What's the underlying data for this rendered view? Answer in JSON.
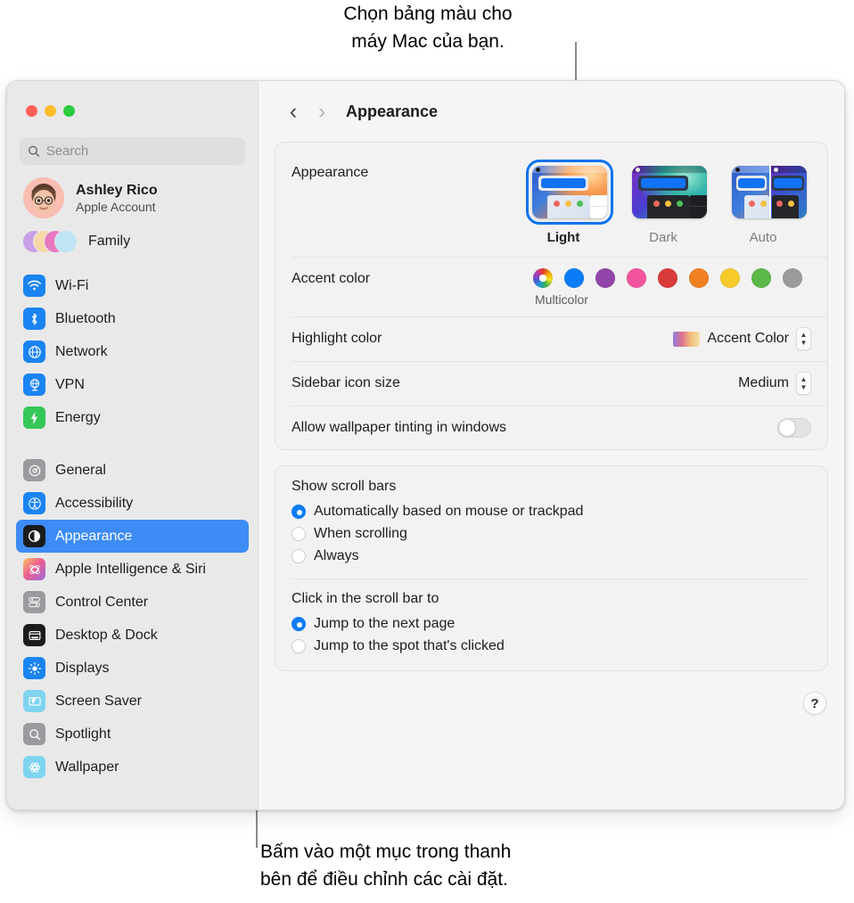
{
  "callouts": {
    "top": "Chọn bảng màu cho\nmáy Mac của bạn.",
    "bottom": "Bấm vào một mục trong thanh\nbên để điều chỉnh các cài đặt."
  },
  "window": {
    "traffic_lights": [
      {
        "name": "close",
        "color": "#ff6159"
      },
      {
        "name": "minimize",
        "color": "#ffbd2e"
      },
      {
        "name": "zoom",
        "color": "#2bcc3e"
      }
    ]
  },
  "sidebar": {
    "search": {
      "value": "",
      "placeholder": "Search",
      "icon": "search-icon"
    },
    "account": {
      "name": "Ashley Rico",
      "subtitle": "Apple Account"
    },
    "family": {
      "label": "Family"
    },
    "groups": [
      {
        "items": [
          {
            "label": "Wi-Fi",
            "icon": "wifi-icon",
            "color": "#1a84f2",
            "glyph": "◗"
          },
          {
            "label": "Bluetooth",
            "icon": "bluetooth-icon",
            "color": "#1a84f2",
            "glyph": "ᛒ"
          },
          {
            "label": "Network",
            "icon": "network-icon",
            "color": "#1a84f2",
            "glyph": "🌐"
          },
          {
            "label": "VPN",
            "icon": "vpn-icon",
            "color": "#1a84f2",
            "glyph": "🌐"
          },
          {
            "label": "Energy",
            "icon": "energy-icon",
            "color": "#34c759",
            "glyph": "⚡"
          }
        ]
      },
      {
        "items": [
          {
            "label": "General",
            "icon": "gear-icon",
            "color": "#8e8e93",
            "glyph": "⚙"
          },
          {
            "label": "Accessibility",
            "icon": "accessibility-icon",
            "color": "#1a84f2",
            "glyph": "♿"
          },
          {
            "label": "Appearance",
            "icon": "appearance-icon",
            "color": "#1c1c1e",
            "glyph": "◑",
            "selected": true
          },
          {
            "label": "Apple Intelligence & Siri",
            "icon": "siri-icon",
            "color": "#e8558f",
            "glyph": "✺"
          },
          {
            "label": "Control Center",
            "icon": "control-center-icon",
            "color": "#8e8e93",
            "glyph": "⦿"
          },
          {
            "label": "Desktop & Dock",
            "icon": "desktop-dock-icon",
            "color": "#1c1c1e",
            "glyph": "▤"
          },
          {
            "label": "Displays",
            "icon": "displays-icon",
            "color": "#1a84f2",
            "glyph": "☀"
          },
          {
            "label": "Screen Saver",
            "icon": "screen-saver-icon",
            "color": "#7fd4f0",
            "glyph": "☾"
          },
          {
            "label": "Spotlight",
            "icon": "spotlight-icon",
            "color": "#8e8e93",
            "glyph": "🔍"
          },
          {
            "label": "Wallpaper",
            "icon": "wallpaper-icon",
            "color": "#7fd4f0",
            "glyph": "✳"
          }
        ]
      }
    ]
  },
  "detail": {
    "nav": {
      "back_icon": "chevron-left-icon",
      "forward_icon": "chevron-right-icon",
      "title": "Appearance"
    },
    "appearance": {
      "label": "Appearance",
      "modes": [
        {
          "label": "Light",
          "selected": true
        },
        {
          "label": "Dark",
          "selected": false
        },
        {
          "label": "Auto",
          "selected": false
        }
      ]
    },
    "accent": {
      "label": "Accent color",
      "caption": "Multicolor",
      "colors": [
        {
          "name": "multicolor",
          "hex": "multicolor",
          "selected": true
        },
        {
          "name": "blue",
          "hex": "#0a7cf5"
        },
        {
          "name": "purple",
          "hex": "#9245a8"
        },
        {
          "name": "pink",
          "hex": "#f2549d"
        },
        {
          "name": "red",
          "hex": "#d93a3a"
        },
        {
          "name": "orange",
          "hex": "#ef8122"
        },
        {
          "name": "yellow",
          "hex": "#f7ca2b"
        },
        {
          "name": "green",
          "hex": "#5cb846"
        },
        {
          "name": "graphite",
          "hex": "#9a9a9a"
        }
      ]
    },
    "highlight_color": {
      "label": "Highlight color",
      "value": "Accent Color"
    },
    "sidebar_icon_size": {
      "label": "Sidebar icon size",
      "value": "Medium"
    },
    "wallpaper_tinting": {
      "label": "Allow wallpaper tinting in windows",
      "on": false
    },
    "scroll_bars": {
      "title": "Show scroll bars",
      "options": [
        {
          "label": "Automatically based on mouse or trackpad",
          "selected": true
        },
        {
          "label": "When scrolling",
          "selected": false
        },
        {
          "label": "Always",
          "selected": false
        }
      ]
    },
    "scroll_click": {
      "title": "Click in the scroll bar to",
      "options": [
        {
          "label": "Jump to the next page",
          "selected": true
        },
        {
          "label": "Jump to the spot that's clicked",
          "selected": false
        }
      ]
    },
    "help": {
      "label": "?"
    }
  }
}
